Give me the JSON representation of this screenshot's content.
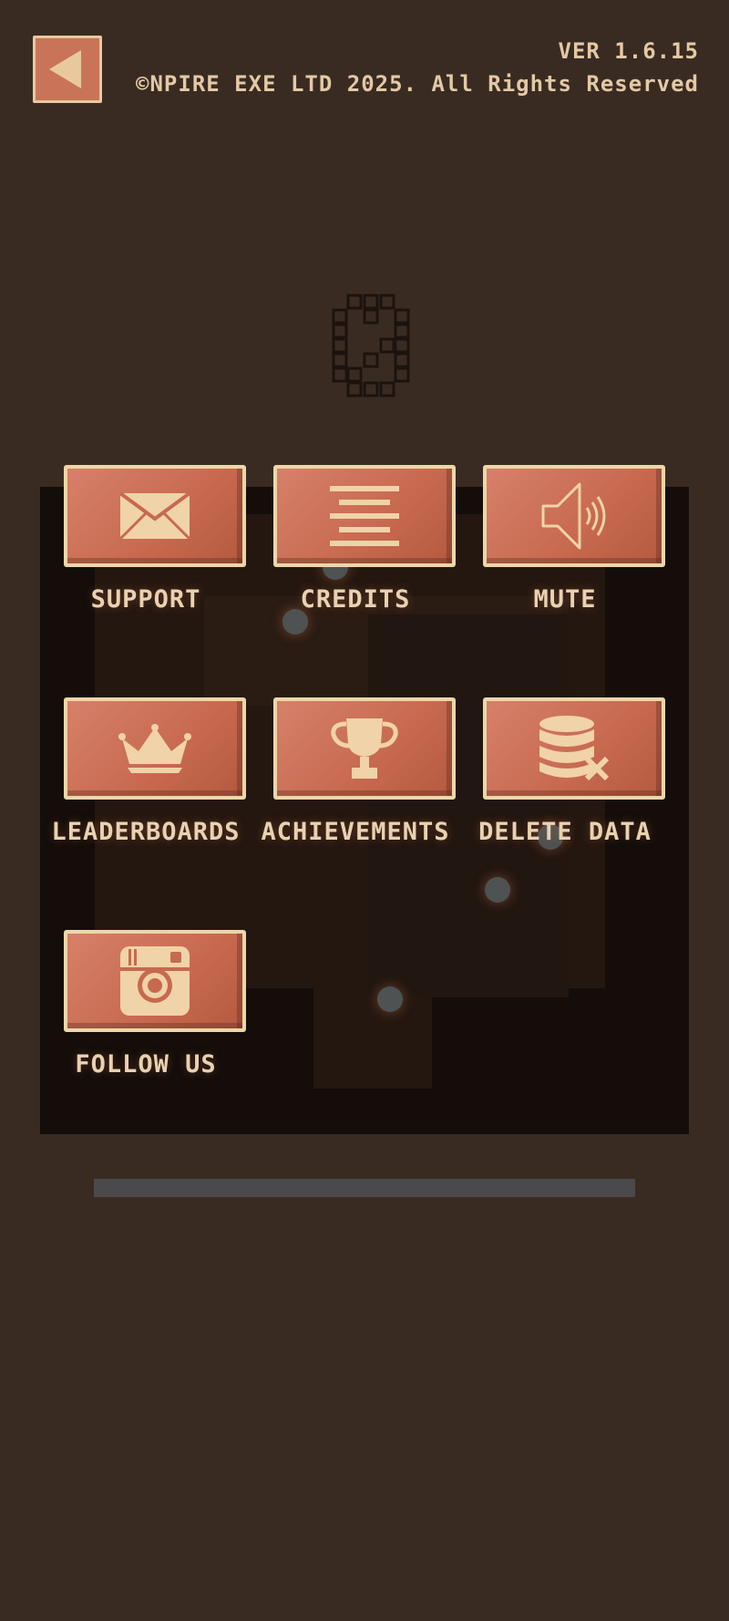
{
  "header": {
    "version": "VER 1.6.15",
    "copyright": "©NPIRE EXE LTD 2025. All Rights Reserved"
  },
  "menu": [
    {
      "label": "SUPPORT",
      "icon": "mail-icon"
    },
    {
      "label": "CREDITS",
      "icon": "text-lines-icon"
    },
    {
      "label": "MUTE",
      "icon": "speaker-icon"
    },
    {
      "label": "LEADERBOARDS",
      "icon": "crown-icon"
    },
    {
      "label": "ACHIEVEMENTS",
      "icon": "trophy-icon"
    },
    {
      "label": "DELETE DATA",
      "icon": "database-delete-icon"
    },
    {
      "label": "FOLLOW US",
      "icon": "instagram-icon"
    }
  ],
  "colors": {
    "background": "#3a2b22",
    "button": "#c97458",
    "button_border": "#ecd7a8",
    "label": "#e8d2b2",
    "panel": "#140d0a"
  }
}
